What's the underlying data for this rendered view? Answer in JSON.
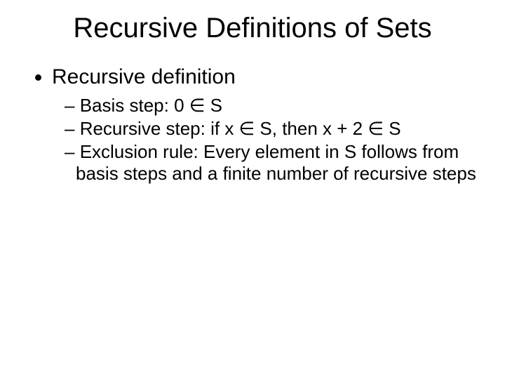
{
  "title": "Recursive Definitions of Sets",
  "b1": "Recursive definition",
  "s1": "Basis step:  0 ∈ S",
  "s2": "Recursive step:  if x ∈ S, then x + 2 ∈ S",
  "s3": "Exclusion rule:  Every element in S follows from basis steps and a finite number of recursive steps"
}
